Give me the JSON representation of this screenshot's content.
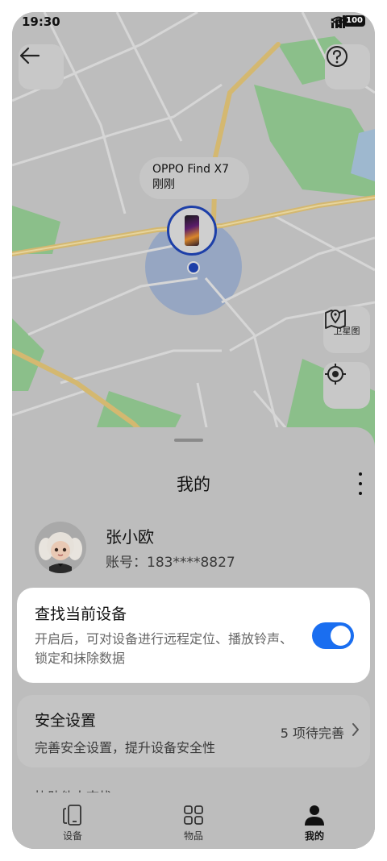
{
  "status_bar": {
    "time": "19:30",
    "network": "5G",
    "battery": "100"
  },
  "map": {
    "device_label_name": "OPPO Find X7",
    "device_label_time": "刚刚",
    "satellite_label": "卫星图"
  },
  "sheet": {
    "title": "我的",
    "user": {
      "name": "张小欧",
      "account": "账号：183****8827"
    },
    "find_card": {
      "title": "查找当前设备",
      "description": "开启后，可对设备进行远程定位、播放铃声、锁定和抹除数据",
      "toggle_on": true
    },
    "security_card": {
      "title": "安全设置",
      "description": "完善安全设置，提升设备安全性",
      "status": "5 项待完善"
    },
    "partial_text": "协助他人查找"
  },
  "tabs": [
    {
      "label": "设备",
      "icon": "phones-icon"
    },
    {
      "label": "物品",
      "icon": "grid-icon"
    },
    {
      "label": "我的",
      "icon": "person-icon"
    }
  ],
  "colors": {
    "accent": "#1a6ef0",
    "pin_ring": "#1d3fa8",
    "card_bg": "#ffffff",
    "overlay": "#bdbdbd"
  }
}
